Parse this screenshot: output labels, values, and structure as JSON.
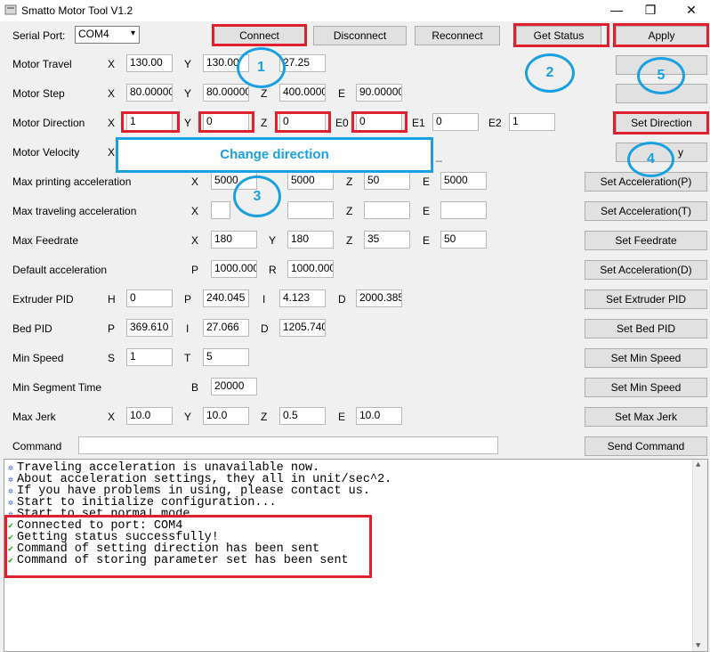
{
  "window": {
    "title": "Smatto Motor Tool V1.2",
    "minimize_glyph": "—",
    "maximize_glyph": "❐",
    "close_glyph": "✕"
  },
  "serial": {
    "label": "Serial Port:",
    "value": "COM4"
  },
  "toolbar": {
    "connect": "Connect",
    "disconnect": "Disconnect",
    "reconnect": "Reconnect",
    "get_status": "Get Status",
    "apply": "Apply"
  },
  "annotations": {
    "change_direction": "Change direction",
    "step1": "1",
    "step2": "2",
    "step3": "3",
    "step4": "4",
    "step5": "5"
  },
  "rows": {
    "motor_travel": {
      "label": "Motor Travel",
      "x": "130.00",
      "y": "130.00",
      "z_partial": "27.25"
    },
    "motor_step": {
      "label": "Motor Step",
      "x": "80.000000",
      "y": "80.000000",
      "z": "400.00000",
      "e": "90.000000"
    },
    "motor_direction": {
      "label": "Motor Direction",
      "x": "1",
      "y": "0",
      "z": "0",
      "e0": "0",
      "e1": "0",
      "e2": "1",
      "button": "Set Direction"
    },
    "motor_velocity": {
      "label": "Motor Velocity",
      "button_partial": "y"
    },
    "max_print_acc": {
      "label": "Max printing acceleration",
      "x": "5000",
      "y": "5000",
      "z": "50",
      "e": "5000",
      "button": "Set Acceleration(P)"
    },
    "max_travel_acc": {
      "label": "Max traveling acceleration",
      "x": "",
      "y": "",
      "z": "",
      "e": "",
      "button": "Set Acceleration(T)"
    },
    "max_feedrate": {
      "label": "Max Feedrate",
      "x": "180",
      "y": "180",
      "z": "35",
      "e": "50",
      "button": "Set Feedrate"
    },
    "default_acc": {
      "label": "Default acceleration",
      "p": "1000.0000",
      "r": "1000.0000",
      "button": "Set Acceleration(D)"
    },
    "extruder_pid": {
      "label": "Extruder PID",
      "h": "0",
      "p": "240.045",
      "i": "4.123",
      "d": "2000.385",
      "button": "Set Extruder PID"
    },
    "bed_pid": {
      "label": "Bed PID",
      "p": "369.610",
      "i": "27.066",
      "d": "1205.740",
      "button": "Set Bed PID"
    },
    "min_speed": {
      "label": "Min Speed",
      "s": "1",
      "t": "5",
      "button": "Set Min Speed"
    },
    "min_segment_time": {
      "label": "Min Segment Time",
      "b": "20000",
      "button": "Set Min Speed"
    },
    "max_jerk": {
      "label": "Max Jerk",
      "x": "10.0",
      "y": "10.0",
      "z": "0.5",
      "e": "10.0",
      "button": "Set Max Jerk"
    },
    "command": {
      "label": "Command",
      "value": "",
      "button": "Send Command"
    }
  },
  "axis_letters": {
    "x": "X",
    "y": "Y",
    "z": "Z",
    "e": "E",
    "e0": "E0",
    "e1": "E1",
    "e2": "E2",
    "p": "P",
    "r": "R",
    "h": "H",
    "i": "I",
    "d": "D",
    "s": "S",
    "t": "T",
    "b": "B"
  },
  "console": {
    "info_icon": "✲",
    "ok_icon": "✔",
    "info_lines": [
      "Traveling acceleration is unavailable now.",
      "About acceleration settings, they all in unit/sec^2.",
      "If you have problems in using, please contact us.",
      "Start to initialize configuration...",
      "Start to set normal mode"
    ],
    "ok_lines": [
      "Connected to port: COM4",
      "Getting status successfully!",
      "Command of setting direction has been sent",
      "Command of storing parameter set has been sent"
    ]
  },
  "colors": {
    "annotation_red": "#e0202e",
    "annotation_blue": "#1aa0e0",
    "ok_green": "#18a818",
    "info_blue": "#2b5fd4"
  }
}
